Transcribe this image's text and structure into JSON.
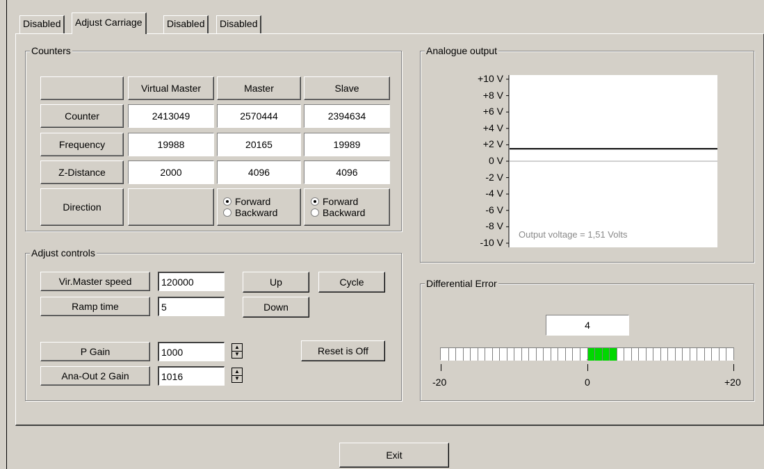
{
  "tabs": [
    {
      "label": "Disabled",
      "active": false
    },
    {
      "label": "Adjust Carriage",
      "active": true
    },
    {
      "label": "Disabled",
      "active": false
    },
    {
      "label": "Disabled",
      "active": false
    }
  ],
  "counters": {
    "title": "Counters",
    "columns": [
      "",
      "Virtual Master",
      "Master",
      "Slave"
    ],
    "rows": [
      {
        "label": "Counter",
        "values": [
          "2413049",
          "2570444",
          "2394634"
        ]
      },
      {
        "label": "Frequency",
        "values": [
          "19988",
          "20165",
          "19989"
        ]
      },
      {
        "label": "Z-Distance",
        "values": [
          "2000",
          "4096",
          "4096"
        ]
      }
    ],
    "direction": {
      "label": "Direction",
      "options": [
        "Forward",
        "Backward"
      ],
      "master_selected": "Forward",
      "slave_selected": "Forward"
    }
  },
  "adjust": {
    "title": "Adjust controls",
    "vir_master_speed_label": "Vir.Master speed",
    "vir_master_speed_value": "120000",
    "ramp_time_label": "Ramp time",
    "ramp_time_value": "5",
    "up_label": "Up",
    "down_label": "Down",
    "cycle_label": "Cycle",
    "p_gain_label": "P Gain",
    "p_gain_value": "1000",
    "ana_out_label": "Ana-Out 2 Gain",
    "ana_out_value": "1016",
    "reset_label": "Reset is Off"
  },
  "analogue": {
    "title": "Analogue output",
    "y_labels": [
      "+10 V",
      "+8 V",
      "+6 V",
      "+4 V",
      "+2 V",
      "0 V",
      "-2 V",
      "-4 V",
      "-6 V",
      "-8 V",
      "-10 V"
    ],
    "output_text": "Output voltage = 1,51 Volts",
    "voltage": 1.51,
    "range": [
      -10,
      10
    ]
  },
  "differential": {
    "title": "Differential Error",
    "value": "4",
    "min": -20,
    "max": 20,
    "scale_labels": [
      "-20",
      "0",
      "+20"
    ],
    "lit_from": 0,
    "lit_to": 4
  },
  "exit_label": "Exit"
}
